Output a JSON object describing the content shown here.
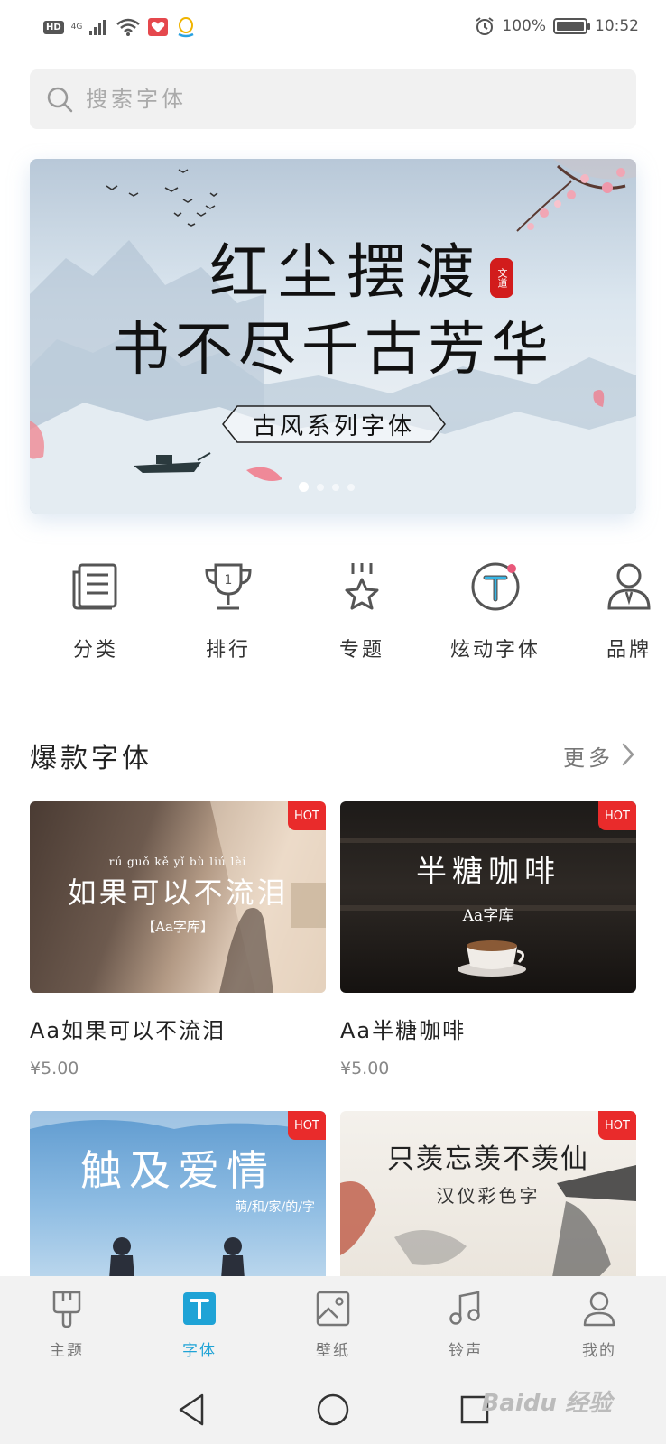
{
  "status_bar": {
    "hd": "HD",
    "signal": "4G",
    "battery": "100%",
    "time": "10:52"
  },
  "search": {
    "placeholder": "搜索字体",
    "icon": "search-icon"
  },
  "banner": {
    "line1": "红尘摆渡",
    "line2": "书不尽千古芳华",
    "seal": "文道",
    "tag": "古风系列字体",
    "dots_count": 4,
    "active_dot": 0
  },
  "categories": [
    {
      "label": "分类",
      "icon": "category-icon"
    },
    {
      "label": "排行",
      "icon": "trophy-icon"
    },
    {
      "label": "专题",
      "icon": "star-topic-icon"
    },
    {
      "label": "炫动字体",
      "icon": "dynamic-font-icon"
    },
    {
      "label": "品牌",
      "icon": "brand-icon"
    }
  ],
  "section": {
    "title": "爆款字体",
    "more": "更多"
  },
  "cards": [
    {
      "name": "Aa如果可以不流泪",
      "price": "¥5.00",
      "badge": "HOT",
      "image_title": "如果可以不流泪",
      "image_pinyin": "rú  guǒ  kě  yǐ  bù  liú  lèi",
      "image_sub": "【Aa字库】"
    },
    {
      "name": "Aa半糖咖啡",
      "price": "¥5.00",
      "badge": "HOT",
      "image_title": "半糖咖啡",
      "image_sub": "Aa字库"
    },
    {
      "badge": "HOT",
      "image_title": "触及爱情",
      "image_sub": "萌/和/家/的/字"
    },
    {
      "badge": "HOT",
      "image_title": "只羡忘羡不羡仙",
      "image_sub": "汉仪彩色字"
    }
  ],
  "bottom_nav": [
    {
      "label": "主题",
      "icon": "theme-brush-icon",
      "active": false
    },
    {
      "label": "字体",
      "icon": "font-t-icon",
      "active": true
    },
    {
      "label": "壁纸",
      "icon": "wallpaper-icon",
      "active": false
    },
    {
      "label": "铃声",
      "icon": "ringtone-music-icon",
      "active": false
    },
    {
      "label": "我的",
      "icon": "profile-icon",
      "active": false
    }
  ],
  "colors": {
    "accent": "#1fa3d6",
    "hot_badge": "#e92b2b",
    "search_bg": "#f1f1f1",
    "nav_bg": "#f2f2f2"
  },
  "watermark": "Baidu 经验"
}
